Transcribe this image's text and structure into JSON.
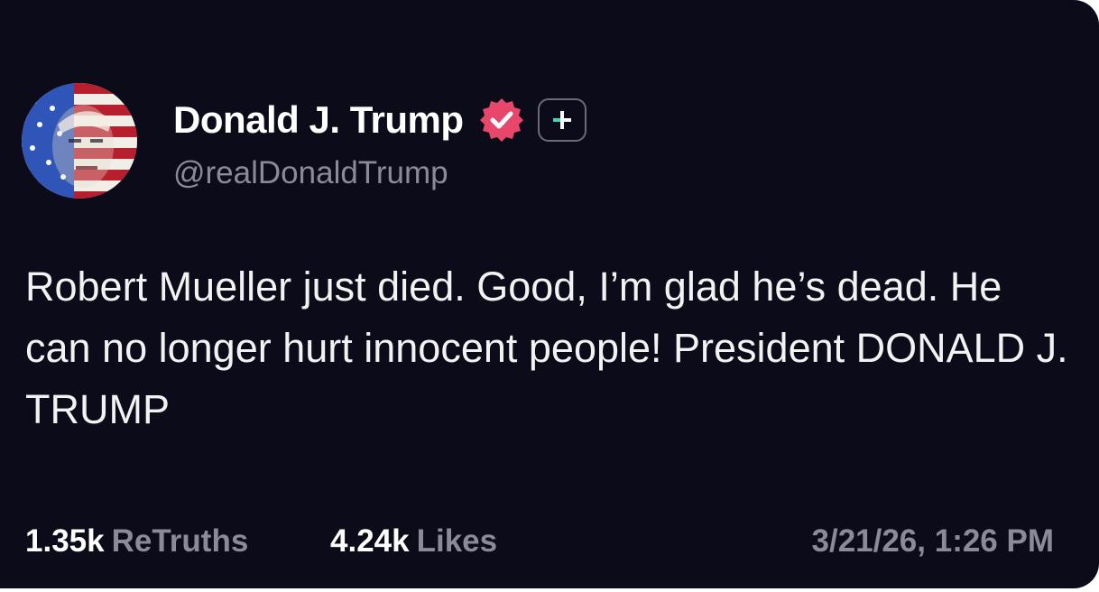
{
  "post": {
    "display_name": "Donald J. Trump",
    "handle": "@realDonaldTrump",
    "text": "Robert Mueller just died. Good, I’m glad he’s dead. He can no longer hurt innocent people! President DONALD J. TRUMP",
    "retruths_count": "1.35k",
    "retruths_label": "ReTruths",
    "likes_count": "4.24k",
    "likes_label": "Likes",
    "timestamp": "3/21/26, 1:26 PM"
  },
  "icons": {
    "avatar": "avatar-image",
    "verified": "verified-badge-icon",
    "plus": "plus-badge-icon"
  },
  "colors": {
    "background": "#0b0b1a",
    "verified_badge": "#e8466b",
    "plus_accent": "#3ad7b0",
    "muted_text": "#8a8a99"
  }
}
